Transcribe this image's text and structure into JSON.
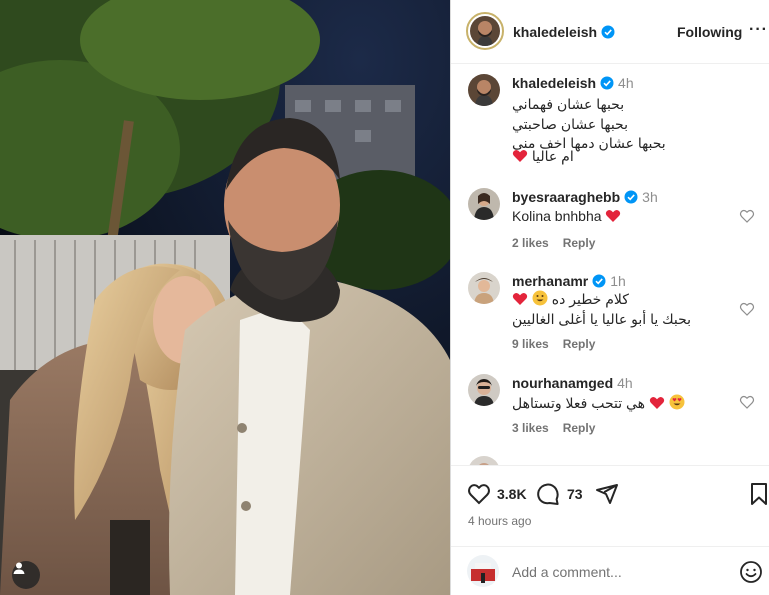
{
  "post": {
    "author": "khaledeleish",
    "follow_label": "Following",
    "more_label": "···"
  },
  "caption": {
    "user": "khaledeleish",
    "time": "4h",
    "lines": [
      "بحبها عشان فهماني",
      "بحبها عشان صاحبتي",
      "بحبها عشان دمها اخف مني",
      "ام عاليا"
    ]
  },
  "comments": [
    {
      "user": "byesraaraghebb",
      "time": "3h",
      "text": "Kolina bnhbha",
      "likes": "2 likes",
      "reply": "Reply"
    },
    {
      "user": "merhanamr",
      "time": "1h",
      "text": "كلام خطير ده",
      "text2": "بحبك يا أبو عاليا يا أغلى الغاليين",
      "likes": "9 likes",
      "reply": "Reply"
    },
    {
      "user": "nourhanamged",
      "time": "4h",
      "text": "هي تتحب فعلا وتستاهل",
      "likes": "3 likes",
      "reply": "Reply"
    }
  ],
  "stats": {
    "likes": "3.8K",
    "comments": "73",
    "posted": "4 hours ago"
  },
  "composer": {
    "placeholder": "Add a comment..."
  },
  "icons": {
    "like": "heart-icon",
    "comment": "comment-icon",
    "share": "share-icon",
    "save": "bookmark-icon",
    "emoji": "smiley-icon",
    "verified": "verified-badge-icon",
    "tag": "user-tag-icon"
  },
  "colors": {
    "verified_blue": "#0095f6",
    "heart_red": "#ed4956",
    "muted_text": "#737373"
  }
}
